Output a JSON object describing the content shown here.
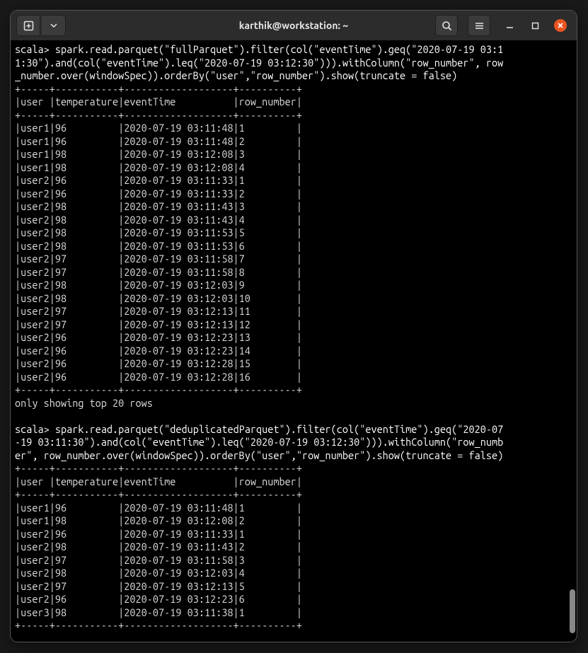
{
  "window": {
    "title": "karthik@workstation: ~"
  },
  "titlebar": {
    "newtab_icon": "new-tab-icon",
    "dropdown_icon": "chevron-down-icon",
    "search_icon": "search-icon",
    "menu_icon": "hamburger-icon",
    "minimize_icon": "minimize-icon",
    "maximize_icon": "maximize-icon",
    "close_icon": "close-icon"
  },
  "term": {
    "prompt": "scala>",
    "cmd1_lines": [
      " spark.read.parquet(\"fullParquet\").filter(col(\"eventTime\").geq(\"2020-07-19 03:1",
      "1:30\").and(col(\"eventTime\").leq(\"2020-07-19 03:12:30\"))).withColumn(\"row_number\", row",
      "_number.over(windowSpec)).orderBy(\"user\",\"row_number\").show(truncate = false)"
    ],
    "sep": "+-----+-----------+-------------------+----------+",
    "header": "|user |temperature|eventTime          |row_number|",
    "rows1": [
      "|user1|96         |2020-07-19 03:11:48|1         |",
      "|user1|96         |2020-07-19 03:11:48|2         |",
      "|user1|98         |2020-07-19 03:12:08|3         |",
      "|user1|98         |2020-07-19 03:12:08|4         |",
      "|user2|96         |2020-07-19 03:11:33|1         |",
      "|user2|96         |2020-07-19 03:11:33|2         |",
      "|user2|98         |2020-07-19 03:11:43|3         |",
      "|user2|98         |2020-07-19 03:11:43|4         |",
      "|user2|98         |2020-07-19 03:11:53|5         |",
      "|user2|98         |2020-07-19 03:11:53|6         |",
      "|user2|97         |2020-07-19 03:11:58|7         |",
      "|user2|97         |2020-07-19 03:11:58|8         |",
      "|user2|98         |2020-07-19 03:12:03|9         |",
      "|user2|98         |2020-07-19 03:12:03|10        |",
      "|user2|97         |2020-07-19 03:12:13|11        |",
      "|user2|97         |2020-07-19 03:12:13|12        |",
      "|user2|96         |2020-07-19 03:12:23|13        |",
      "|user2|96         |2020-07-19 03:12:23|14        |",
      "|user2|96         |2020-07-19 03:12:28|15        |",
      "|user2|96         |2020-07-19 03:12:28|16        |"
    ],
    "truncmsg": "only showing top 20 rows",
    "cmd2_lines": [
      " spark.read.parquet(\"deduplicatedParquet\").filter(col(\"eventTime\").geq(\"2020-07",
      "-19 03:11:30\").and(col(\"eventTime\").leq(\"2020-07-19 03:12:30\"))).withColumn(\"row_numb",
      "er\", row_number.over(windowSpec)).orderBy(\"user\",\"row_number\").show(truncate = false)"
    ],
    "rows2": [
      "|user1|96         |2020-07-19 03:11:48|1         |",
      "|user1|98         |2020-07-19 03:12:08|2         |",
      "|user2|96         |2020-07-19 03:11:33|1         |",
      "|user2|98         |2020-07-19 03:11:43|2         |",
      "|user2|97         |2020-07-19 03:11:58|3         |",
      "|user2|98         |2020-07-19 03:12:03|4         |",
      "|user2|97         |2020-07-19 03:12:13|5         |",
      "|user2|96         |2020-07-19 03:12:23|6         |",
      "|user3|98         |2020-07-19 03:11:38|1         |"
    ]
  }
}
